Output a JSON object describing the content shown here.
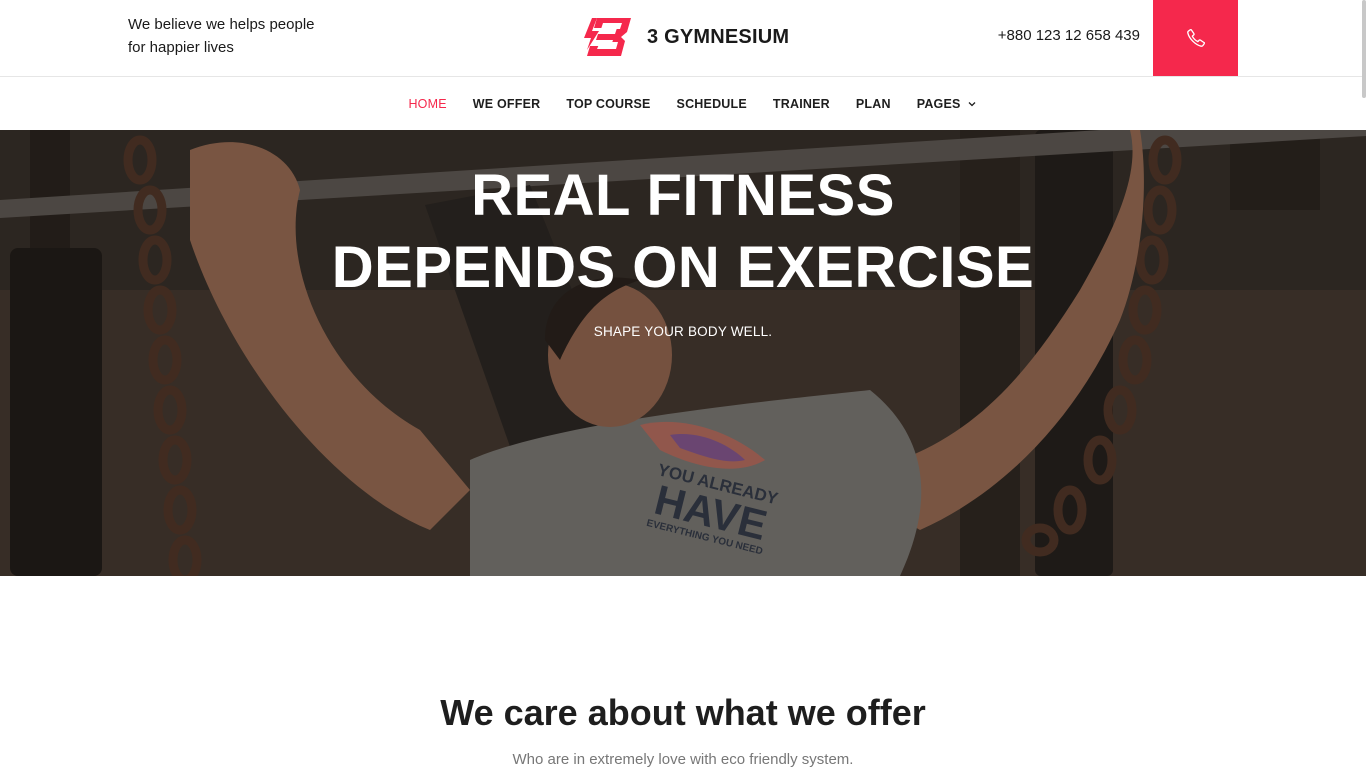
{
  "header": {
    "tagline_line1": "We believe we helps people",
    "tagline_line2": "for happier lives",
    "logo_icon": "bolt-3-logo-icon",
    "brand_name": "3 GYMNESIUM",
    "phone": "+880 123 12 658 439",
    "phone_icon": "phone-icon"
  },
  "nav": {
    "items": [
      {
        "label": "HOME",
        "active": true
      },
      {
        "label": "WE OFFER"
      },
      {
        "label": "TOP COURSE"
      },
      {
        "label": "SCHEDULE"
      },
      {
        "label": "TRAINER"
      },
      {
        "label": "PLAN"
      },
      {
        "label": "PAGES",
        "has_dropdown": true
      }
    ]
  },
  "hero": {
    "title_line1": "REAL FITNESS",
    "title_line2": "DEPENDS ON EXERCISE",
    "subtitle": "SHAPE YOUR BODY WELL.",
    "shirt_line1": "YOU ALREADY",
    "shirt_line2": "HAVE",
    "shirt_line3": "EVERYTHING YOU NEED"
  },
  "offer": {
    "title": "We care about what we offer",
    "subtitle": "Who are in extremely love with eco friendly system."
  },
  "colors": {
    "accent": "#f5284c",
    "text_dark": "#1e1e1e",
    "text_muted": "#777777"
  }
}
